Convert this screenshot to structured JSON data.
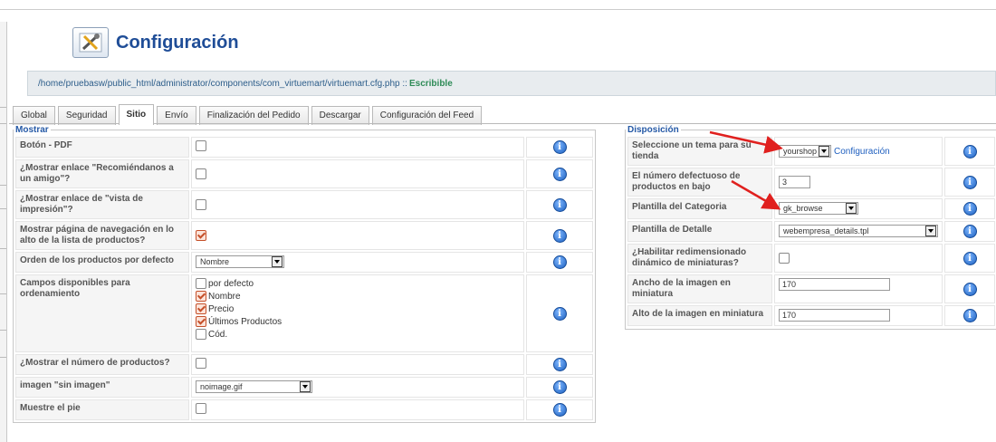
{
  "header": {
    "title": "Configuración",
    "icon": "config-tools-icon"
  },
  "path": {
    "text": "/home/pruebasw/public_html/administrator/components/com_virtuemart/virtuemart.cfg.php :: ",
    "status": "Escribible"
  },
  "tabs": [
    {
      "label": "Global"
    },
    {
      "label": "Seguridad"
    },
    {
      "label": "Sitio",
      "active": true
    },
    {
      "label": "Envío"
    },
    {
      "label": "Finalización del Pedido"
    },
    {
      "label": "Descargar"
    },
    {
      "label": "Configuración del Feed"
    }
  ],
  "mostrar": {
    "legend": "Mostrar",
    "rows": {
      "pdf": {
        "label": "Botón - PDF",
        "checked": false
      },
      "recomiendanos": {
        "label": "¿Mostrar enlace \"Recomiéndanos a un amigo\"?",
        "checked": false
      },
      "impresion": {
        "label": "¿Mostrar enlace de \"vista de impresión\"?",
        "checked": false
      },
      "navegacion": {
        "label": "Mostrar página de navegación en lo alto de la lista de productos?",
        "checked": true
      },
      "orden": {
        "label": "Orden de los productos por defecto",
        "value": "Nombre"
      },
      "campos": {
        "label": "Campos disponibles para ordenamiento",
        "options": [
          {
            "label": "por defecto",
            "checked": false
          },
          {
            "label": "Nombre",
            "checked": true
          },
          {
            "label": "Precio",
            "checked": true
          },
          {
            "label": "Últimos Productos",
            "checked": true
          },
          {
            "label": "Cód.",
            "checked": false
          }
        ]
      },
      "numero": {
        "label": "¿Mostrar el número de productos?",
        "checked": false
      },
      "sinimagen": {
        "label": "imagen \"sin imagen\"",
        "value": "noimage.gif"
      },
      "pie": {
        "label": "Muestre el pie",
        "checked": false
      }
    }
  },
  "disposicion": {
    "legend": "Disposición",
    "rows": {
      "tema": {
        "label": "Seleccione un tema para su tienda",
        "value": "yourshop",
        "link": "Configuración"
      },
      "numero": {
        "label": "El número defectuoso de productos en bajo",
        "value": "3"
      },
      "categoria": {
        "label": "Plantilla del Categoria",
        "value": "gk_browse"
      },
      "detalle": {
        "label": "Plantilla de Detalle",
        "value": "webempresa_details.tpl"
      },
      "redimensionado": {
        "label": "¿Habilitar redimensionado dinámico de miniaturas?",
        "checked": false
      },
      "ancho": {
        "label": "Ancho de la imagen en miniatura",
        "value": "170"
      },
      "alto": {
        "label": "Alto de la imagen en miniatura",
        "value": "170"
      }
    }
  },
  "info_icon": "info-icon",
  "colors": {
    "title": "#1f4d97",
    "legend": "#2559a6",
    "status": "#2e8b57",
    "arrow": "#e0201e"
  }
}
